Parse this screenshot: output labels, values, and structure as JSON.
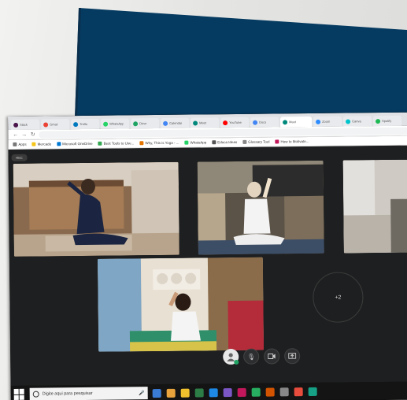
{
  "browser": {
    "tabs": [
      {
        "label": "Slack",
        "color": "#4a154b"
      },
      {
        "label": "Gmail",
        "color": "#ea4335"
      },
      {
        "label": "Trello",
        "color": "#0079bf"
      },
      {
        "label": "WhatsApp",
        "color": "#25d366"
      },
      {
        "label": "Drive",
        "color": "#1fa463"
      },
      {
        "label": "Calendar",
        "color": "#4285f4"
      },
      {
        "label": "Meet",
        "color": "#00897b"
      },
      {
        "label": "YouTube",
        "color": "#ff0000"
      },
      {
        "label": "Docs",
        "color": "#4285f4"
      },
      {
        "label": "Meet",
        "color": "#00897b",
        "active": true
      },
      {
        "label": "Zoom",
        "color": "#2d8cff"
      },
      {
        "label": "Canva",
        "color": "#00c4cc"
      },
      {
        "label": "Spotify",
        "color": "#1db954"
      }
    ],
    "url": "",
    "bookmarks": [
      {
        "label": "Apps",
        "color": "#777"
      },
      {
        "label": "Mercado",
        "color": "#f5c518"
      },
      {
        "label": "Microsoft OneDrive",
        "color": "#0078d4"
      },
      {
        "label": "Best Tools to Use...",
        "color": "#34a853"
      },
      {
        "label": "Why, This is Yoga - ...",
        "color": "#e37400"
      },
      {
        "label": "WhatsApp",
        "color": "#25d366"
      },
      {
        "label": "Educa Ideas",
        "color": "#555"
      },
      {
        "label": "Glossary Tool",
        "color": "#888"
      },
      {
        "label": "How to Motivate...",
        "color": "#c2185b"
      }
    ]
  },
  "meet": {
    "rec_label": "REC",
    "more_participants": "+2"
  },
  "taskbar": {
    "search_placeholder": "Digite aqui para pesquisar",
    "app_icons": [
      "#3a7bd5",
      "#e8a33d",
      "#f2c12e",
      "#2d7d46",
      "#1e88e5",
      "#7b57c6",
      "#c2185b",
      "#27ae60",
      "#d35400",
      "#888888",
      "#e74c3c",
      "#16a085"
    ]
  }
}
